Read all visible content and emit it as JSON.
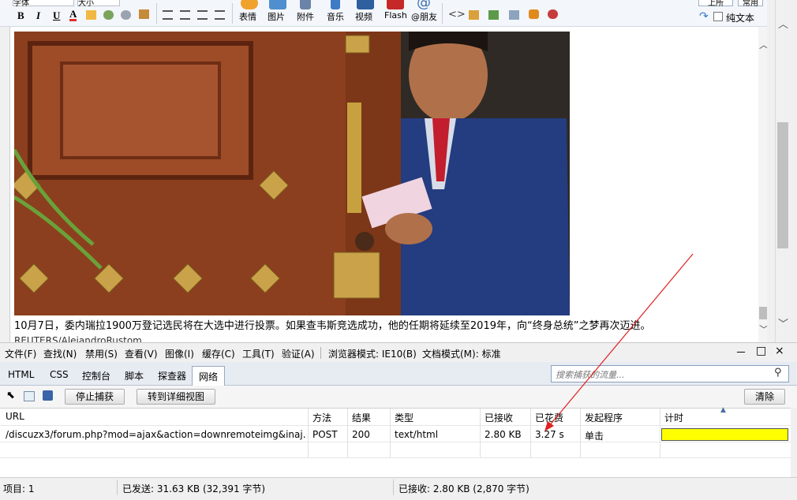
{
  "toolbar": {
    "font_name": "字体",
    "font_size": "大小",
    "format_buttons": [
      "B",
      "I",
      "U",
      "A"
    ],
    "insert_items": [
      {
        "label": "表情",
        "icon": "smiley-icon"
      },
      {
        "label": "图片",
        "icon": "image-icon"
      },
      {
        "label": "附件",
        "icon": "paperclip-icon"
      },
      {
        "label": "音乐",
        "icon": "music-icon"
      },
      {
        "label": "视频",
        "icon": "video-icon"
      },
      {
        "label": "Flash",
        "icon": "flash-icon"
      },
      {
        "label": "@朋友",
        "icon": "at-icon"
      }
    ],
    "top_right_buttons": [
      "上所",
      "常用"
    ],
    "plain_text_label": "纯文本"
  },
  "editor": {
    "photo_alt": "photo",
    "caption": "10月7日，委内瑞拉1900万登记选民将在大选中进行投票。如果查韦斯竞选成功，他的任期将延续至2019年，向“终身总统”之梦再次迈进。",
    "credit": "REUTERS/AlejandroRustom"
  },
  "devtools": {
    "menu": [
      "文件(F)",
      "查找(N)",
      "禁用(S)",
      "查看(V)",
      "图像(I)",
      "缓存(C)",
      "工具(T)",
      "验证(A)",
      "浏览器模式: IE10(B)",
      "文档模式(M): 标准"
    ],
    "window_controls": [
      "－",
      "□",
      "×"
    ],
    "tabs": [
      "HTML",
      "CSS",
      "控制台",
      "脚本",
      "探查器",
      "网络"
    ],
    "active_tab": "网络",
    "search_placeholder": "搜索捕获的流量...",
    "stop_capture": "停止捕获",
    "detail_view": "转到详细视图",
    "clear": "清除",
    "columns": [
      "URL",
      "方法",
      "结果",
      "类型",
      "已接收",
      "已花费",
      "发起程序",
      "计时"
    ],
    "rows": [
      {
        "url": "/discuzx3/forum.php?mod=ajax&action=downremoteimg&inaj...",
        "method": "POST",
        "result": "200",
        "type": "text/html",
        "received": "2.80 KB",
        "taken": "3.27 s",
        "initiator": "单击",
        "timing_fraction": 1.0
      }
    ],
    "status": {
      "items": "项目: 1",
      "sent": "已发送: 31.63 KB (32,391 字节)",
      "received": "已接收: 2.80 KB (2,870 字节)"
    }
  },
  "colors": {
    "timing_bar": "#ffff00",
    "annotation_arrow": "#e02020",
    "active_tab_bg": "#ffffff"
  }
}
